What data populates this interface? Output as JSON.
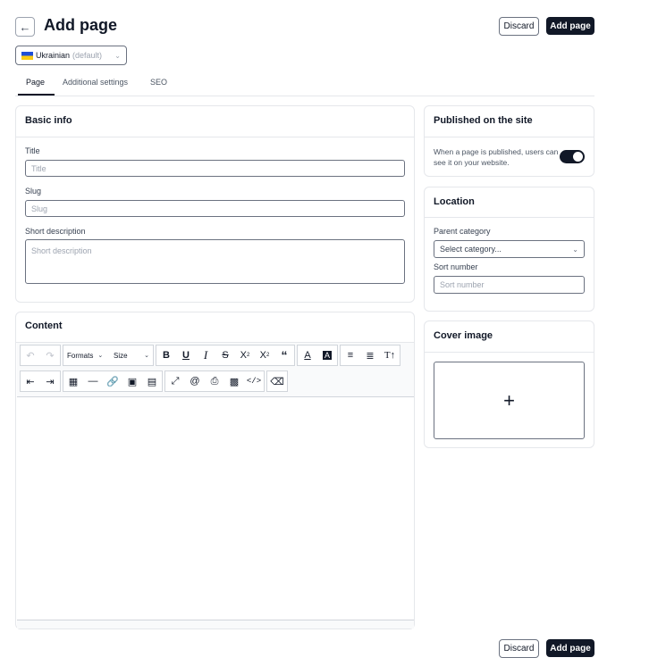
{
  "header": {
    "back_icon": "arrow-left-icon",
    "title": "Add page",
    "discard_label": "Discard",
    "add_label": "Add page"
  },
  "language": {
    "flag_icon": "ukraine-flag-icon",
    "name": "Ukrainian",
    "suffix": "(default)"
  },
  "tabs": [
    {
      "label": "Page",
      "active": true
    },
    {
      "label": "Additional settings",
      "active": false
    },
    {
      "label": "SEO",
      "active": false
    }
  ],
  "basic_info": {
    "title": "Basic info",
    "title_label": "Title",
    "title_placeholder": "Title",
    "slug_label": "Slug",
    "slug_placeholder": "Slug",
    "short_desc_label": "Short description",
    "short_desc_placeholder": "Short description"
  },
  "content": {
    "title": "Content",
    "formats_label": "Formats",
    "size_label": "Size"
  },
  "published": {
    "title": "Published on the site",
    "description": "When a page is published, users can see it on your website.",
    "enabled": true
  },
  "location": {
    "title": "Location",
    "parent_label": "Parent category",
    "parent_placeholder": "Select category...",
    "sort_label": "Sort number",
    "sort_placeholder": "Sort number"
  },
  "cover": {
    "title": "Cover image",
    "add_icon": "plus-icon"
  },
  "footer": {
    "discard_label": "Discard",
    "add_label": "Add page"
  },
  "colors": {
    "primary": "#111827",
    "border": "#6b7280",
    "divider": "#e5e7eb"
  }
}
